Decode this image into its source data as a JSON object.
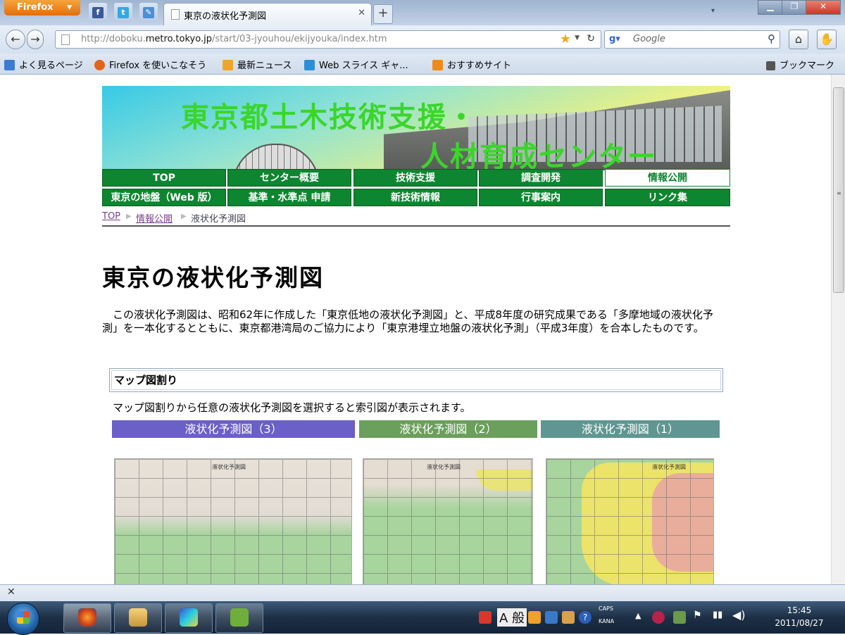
{
  "browser": {
    "menu_button": "Firefox",
    "tab_title": "東京の液状化予測図",
    "url": {
      "host_pre": "http://doboku.",
      "host": "metro.tokyo.jp",
      "path": "/start/03-jyouhou/ekijyouka/index.htm"
    },
    "search_placeholder": "Google",
    "bookmarks": [
      {
        "label": "よく見るページ",
        "icon_color": "#3b7bd4"
      },
      {
        "label": "Firefox を使いこなそう",
        "icon_color": "#e2631b"
      },
      {
        "label": "最新ニュース",
        "icon_color": "#f0a52a"
      },
      {
        "label": "Web スライス ギャ...",
        "icon_color": "#2c8fd6"
      },
      {
        "label": "おすすめサイト",
        "icon_color": "#f08a1c"
      }
    ],
    "bookmarks_menu": "ブックマーク"
  },
  "site": {
    "banner_line1": "東京都土木技術支援・",
    "banner_line2": "人材育成センター",
    "nav_row1": [
      "TOP",
      "センター概要",
      "技術支援",
      "調査開発",
      "情報公開"
    ],
    "nav_row2": [
      "東京の地盤（Web 版）",
      "基準・水準点 申請",
      "新技術情報",
      "行事案内",
      "リンク集"
    ],
    "active_nav": "情報公開",
    "breadcrumb": [
      "TOP",
      "情報公開",
      "液状化予測図"
    ]
  },
  "content": {
    "title": "東京の液状化予測図",
    "intro": "この液状化予測図は、昭和62年に作成した「東京低地の液状化予測図」と、平成8年度の研究成果である「多摩地域の液状化予測」を一本化するとともに、東京都港湾局のご協力により「東京港埋立地盤の液状化予測」（平成3年度）を合本したものです。",
    "map_section_title": "マップ図割り",
    "map_section_desc": "マップ図割りから任意の液状化予測図を選択すると索引図が表示されます。",
    "map_buttons": [
      {
        "label": "液状化予測図（3）",
        "color": "#6b5fc8"
      },
      {
        "label": "液状化予測図（2）",
        "color": "#6b9f5c"
      },
      {
        "label": "液状化予測図（1）",
        "color": "#5f9691"
      }
    ],
    "map_sheet_label": "液状化予測図"
  },
  "taskbar": {
    "ime_mode": "A 般",
    "caps": "CAPS",
    "kana": "KANA",
    "time": "15:45",
    "date": "2011/08/27"
  }
}
